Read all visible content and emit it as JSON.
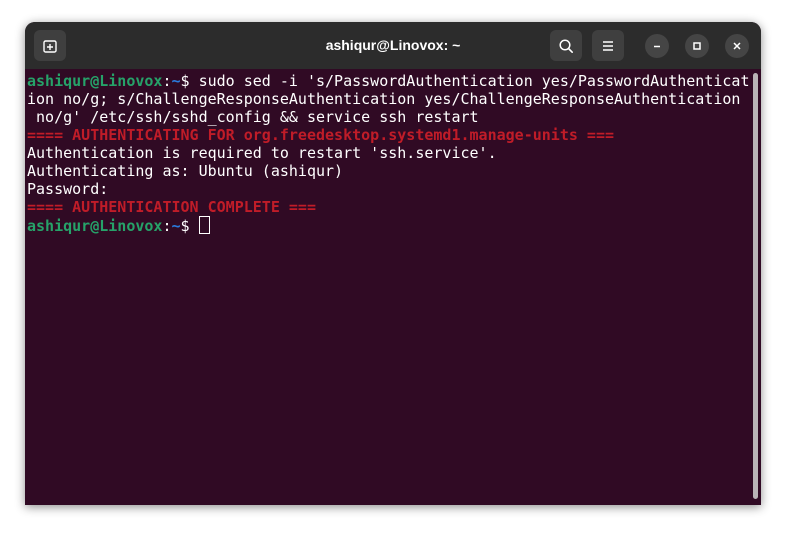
{
  "window": {
    "title": "ashiqur@Linovox: ~"
  },
  "icons": {
    "new_tab": "new-tab-icon",
    "search": "search-icon",
    "menu": "hamburger-menu-icon",
    "minimize": "minimize-icon",
    "maximize": "maximize-icon",
    "close": "close-icon"
  },
  "terminal": {
    "prompt_user": "ashiqur@Linovox",
    "prompt_sep": ":",
    "prompt_path": "~",
    "prompt_symbol": "$ ",
    "command_line1": "sudo sed -i 's/PasswordAuthentication yes/PasswordAuthenticat",
    "command_line2": "ion no/g; s/ChallengeResponseAuthentication yes/ChallengeResponseAuthentication",
    "command_line3": " no/g' /etc/ssh/sshd_config && service ssh restart",
    "auth_header": "==== AUTHENTICATING FOR org.freedesktop.systemd1.manage-units ===",
    "auth_required": "Authentication is required to restart 'ssh.service'.",
    "auth_as": "Authenticating as: Ubuntu (ashiqur)",
    "password_prompt": "Password: ",
    "auth_complete": "==== AUTHENTICATION COMPLETE ==="
  },
  "colors": {
    "terminal_bg": "#300a24",
    "titlebar_bg": "#2c2c2c",
    "prompt_user": "#26a269",
    "prompt_path": "#2a7bde",
    "auth_message": "#c01c28"
  }
}
